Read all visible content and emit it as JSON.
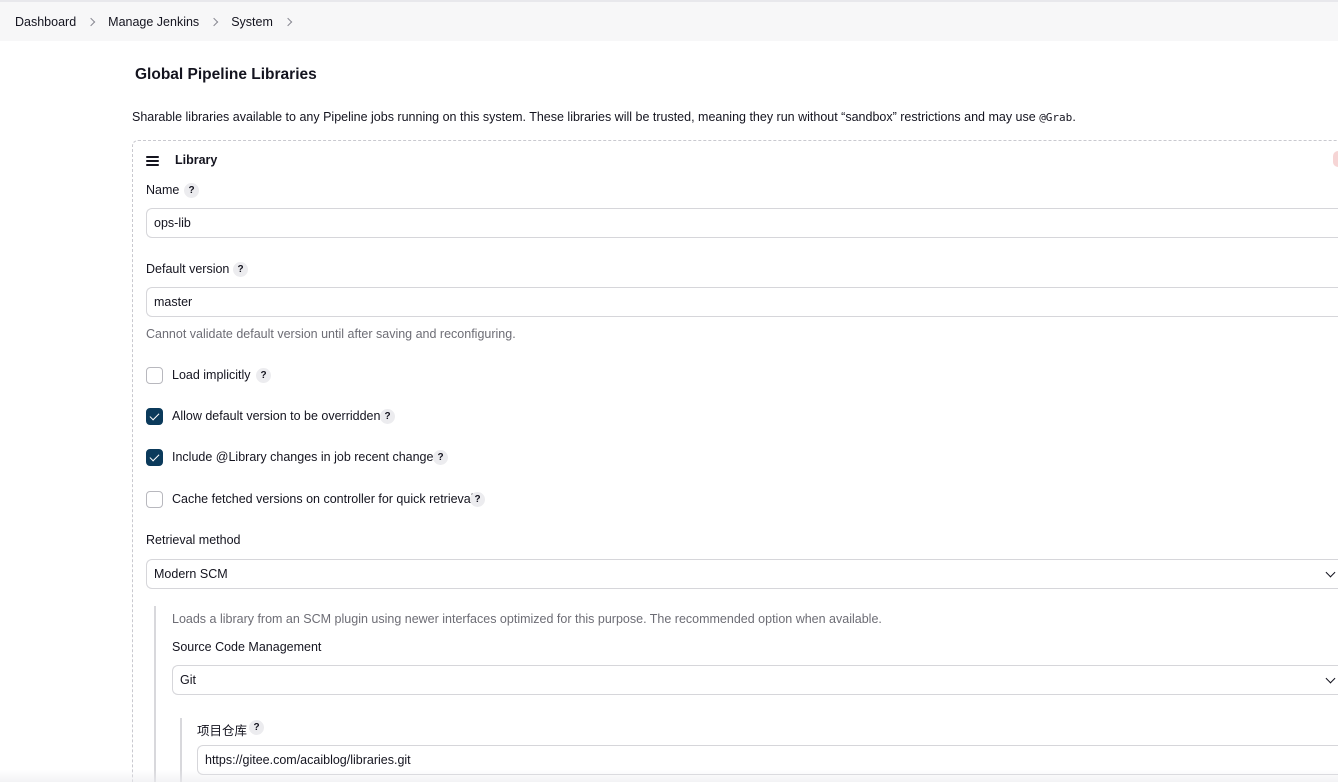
{
  "breadcrumb": {
    "items": [
      "Dashboard",
      "Manage Jenkins",
      "System"
    ]
  },
  "section": {
    "title": "Global Pipeline Libraries",
    "description": "Sharable libraries available to any Pipeline jobs running on this system. These libraries will be trusted, meaning they run without “sandbox” restrictions and may use ",
    "description_code": "@Grab",
    "description_end": "."
  },
  "library": {
    "title": "Library",
    "name_label": "Name",
    "name_value": "ops-lib",
    "default_version_label": "Default version",
    "default_version_value": "master",
    "validation_message": "Cannot validate default version until after saving and reconfiguring.",
    "checkboxes": [
      {
        "label": "Load implicitly",
        "checked": false
      },
      {
        "label": "Allow default version to be overridden",
        "checked": true
      },
      {
        "label": "Include @Library changes in job recent changes",
        "checked": true
      },
      {
        "label": "Cache fetched versions on controller for quick retrieval",
        "checked": false
      }
    ],
    "retrieval_label": "Retrieval method",
    "retrieval_value": "Modern SCM",
    "retrieval_description": "Loads a library from an SCM plugin using newer interfaces optimized for this purpose. The recommended option when available.",
    "scm_label": "Source Code Management",
    "scm_value": "Git",
    "repo_label": "项目仓库",
    "repo_value": "https://gitee.com/acaiblog/libraries.git"
  },
  "help_glyph": "?",
  "colors": {
    "checkbox_checked": "#0b3a5b",
    "breadcrumb_bg": "#f7f7f8",
    "muted_text": "#6d6d75"
  }
}
